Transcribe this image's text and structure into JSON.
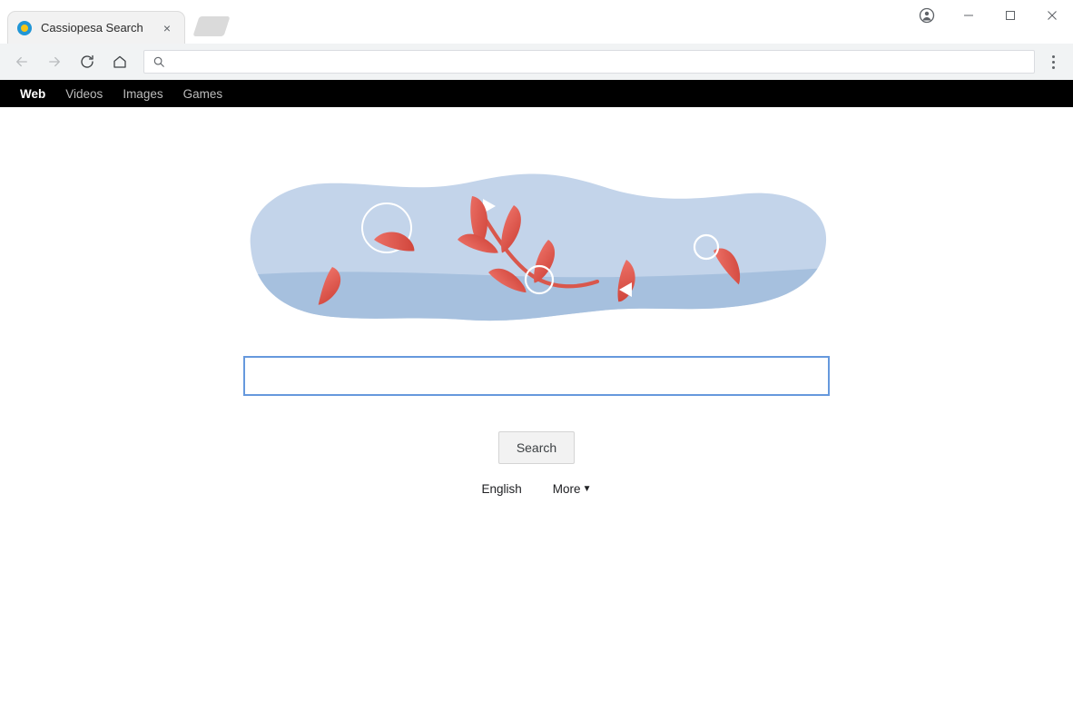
{
  "browser": {
    "tab": {
      "title": "Cassiopesa Search",
      "favicon_name": "cassiopesa-favicon",
      "close_label": "×"
    },
    "newtab_label": "",
    "window_controls": {
      "profile_label": "",
      "minimize_label": "–",
      "maximize_label": "□",
      "close_label": "✕"
    },
    "nav": {
      "back_label": "",
      "forward_label": "",
      "reload_label": "",
      "home_label": ""
    },
    "omnibox": {
      "value": "",
      "placeholder": "",
      "icon_name": "search-icon"
    },
    "menu_label": ""
  },
  "site_nav": {
    "items": [
      {
        "label": "Web",
        "active": true
      },
      {
        "label": "Videos",
        "active": false
      },
      {
        "label": "Images",
        "active": false
      },
      {
        "label": "Games",
        "active": false
      }
    ]
  },
  "doodle": {
    "name": "leaves-in-water-doodle",
    "colors": {
      "blob_light": "#c3d4ea",
      "blob_dark": "#a6c0de",
      "leaf_red": "#e05c50",
      "leaf_red_dark": "#d14a41",
      "accent_white": "#ffffff"
    }
  },
  "search": {
    "input_value": "",
    "input_placeholder": "",
    "button_label": "Search",
    "focus_color": "#6699dd"
  },
  "footer_links": {
    "language_label": "English",
    "more_label": "More",
    "more_caret": "▼"
  }
}
